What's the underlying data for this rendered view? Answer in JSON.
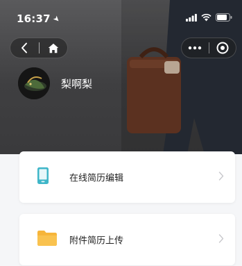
{
  "status_bar": {
    "time": "16:37",
    "location_glyph": "➤"
  },
  "nav": {
    "back_icon": "chevron-left-icon",
    "home_icon": "home-icon"
  },
  "capsule": {
    "more_glyph": "•••",
    "close_icon": "target-icon"
  },
  "profile": {
    "username": "梨啊梨"
  },
  "menu": {
    "items": [
      {
        "label": "在线简历编辑",
        "icon": "phone-icon",
        "color": "#3fb6c8"
      },
      {
        "label": "附件简历上传",
        "icon": "folder-icon",
        "color": "#f6b53a"
      }
    ]
  },
  "colors": {
    "hero_bg": "#4a4a4c",
    "page_bg": "#f5f6f8",
    "chevron": "#c8c8cc"
  }
}
